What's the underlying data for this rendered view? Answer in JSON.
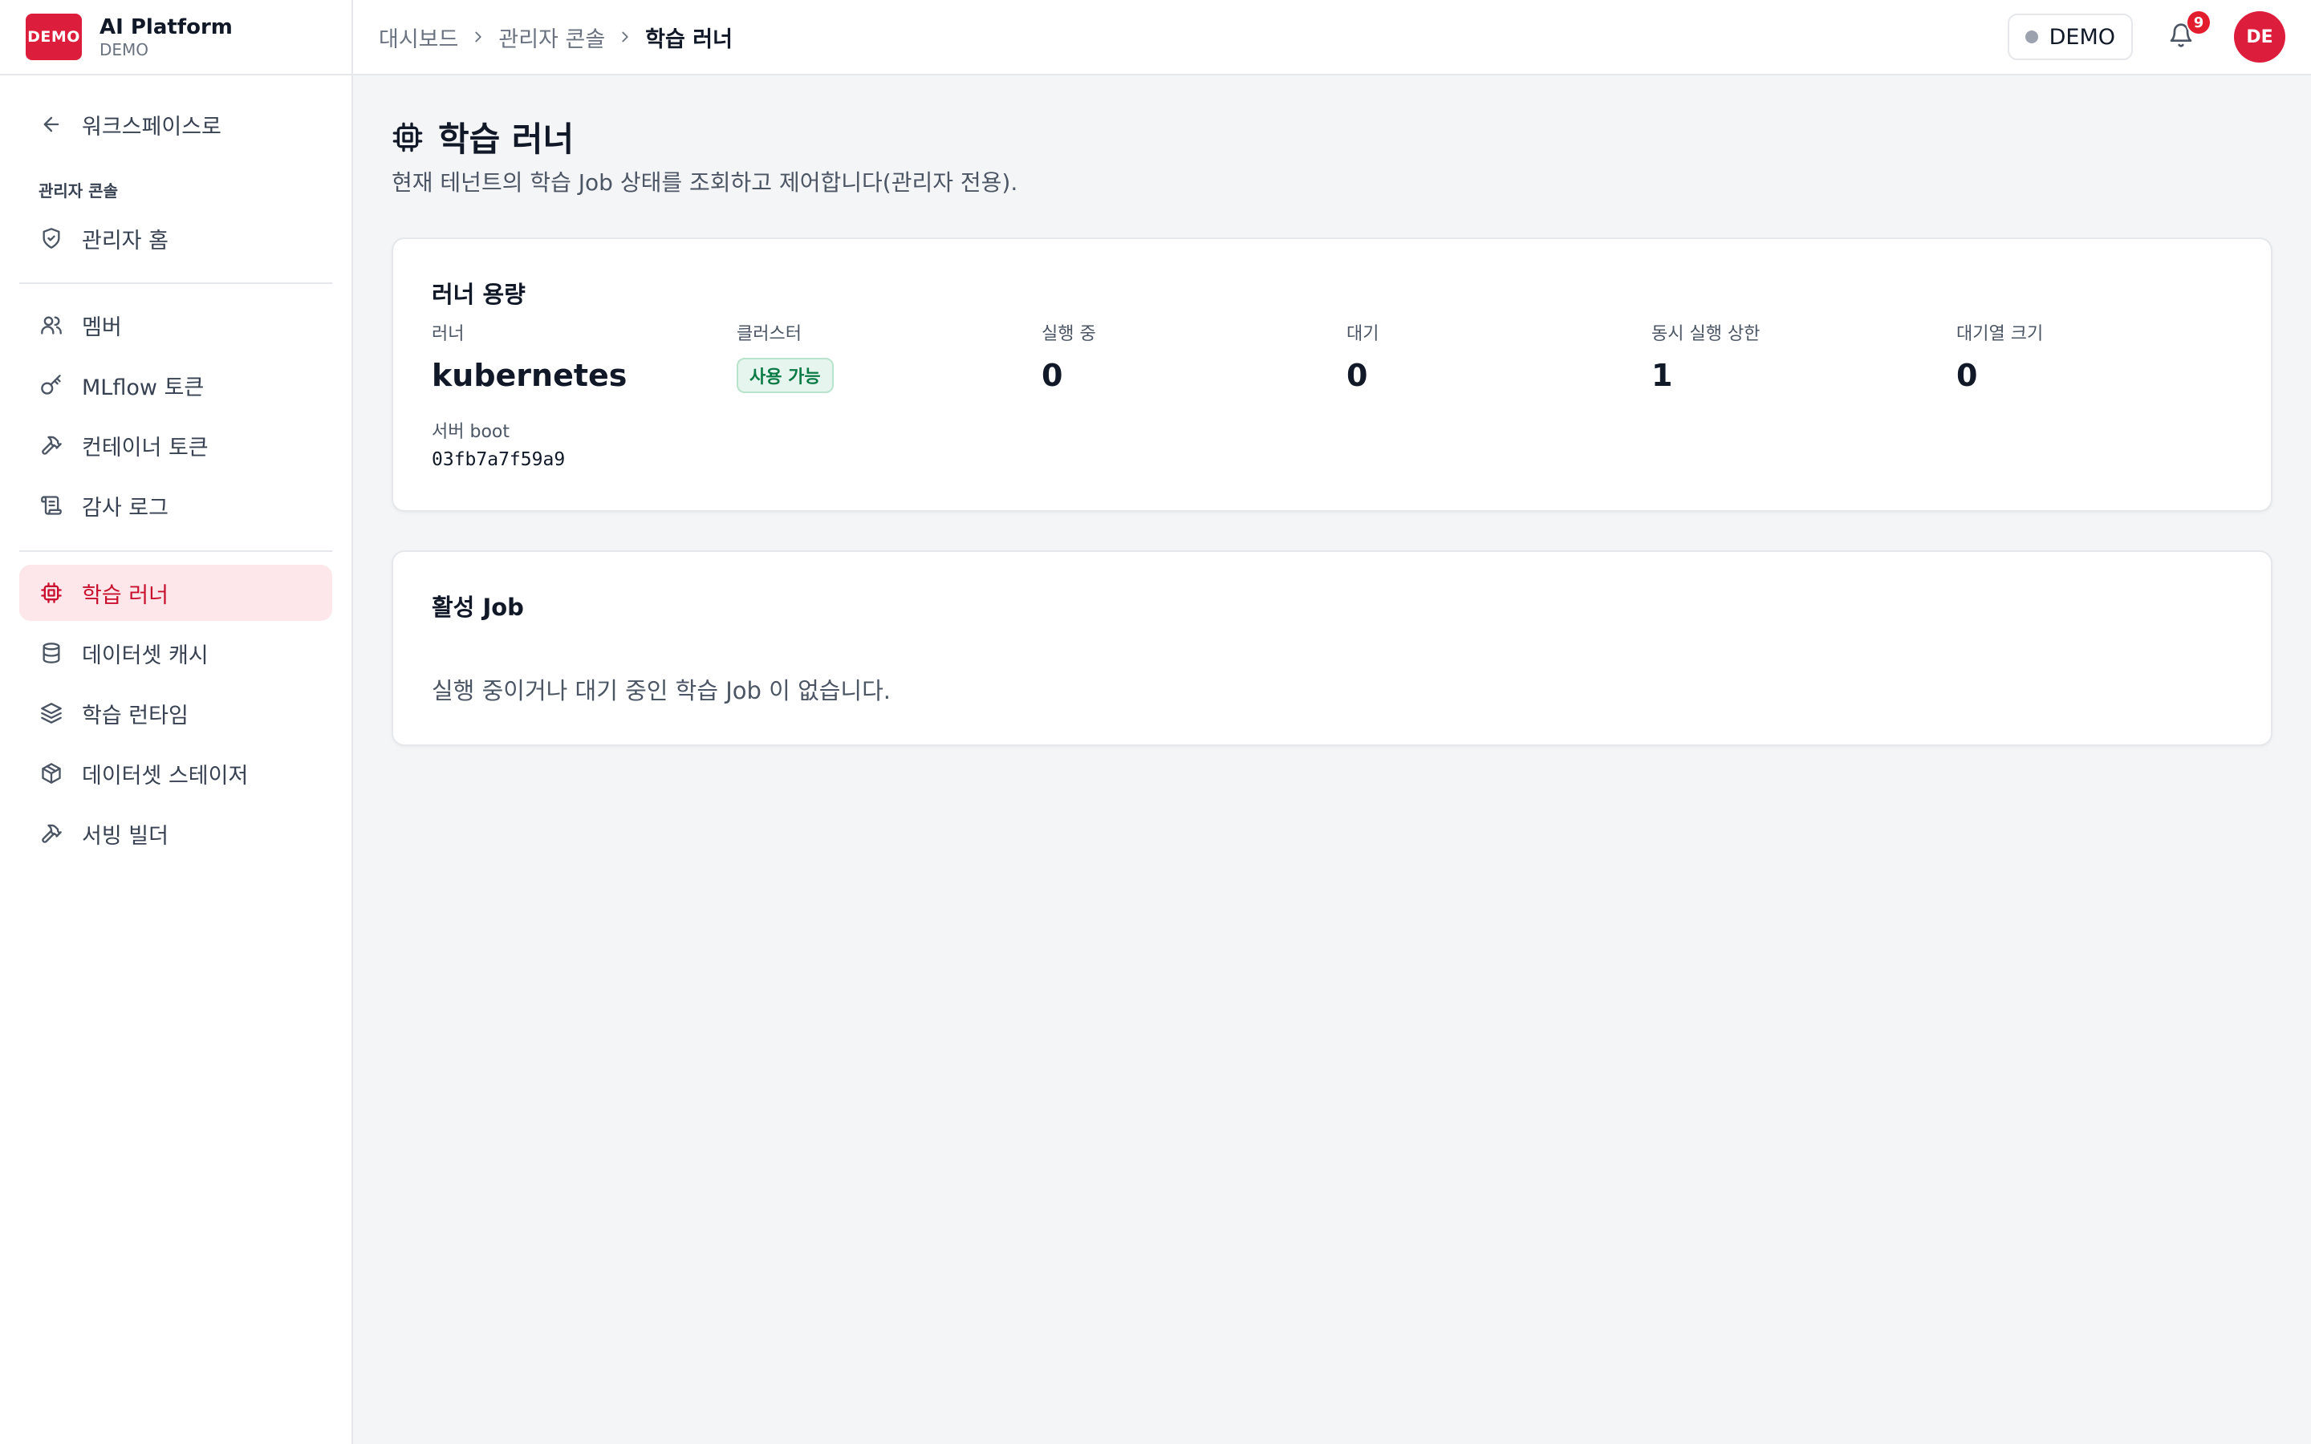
{
  "brand": {
    "logo": "DEMO",
    "title": "AI Platform",
    "subtitle": "DEMO"
  },
  "sidebar": {
    "back_label": "워크스페이스로",
    "section_label": "관리자 콘솔",
    "items": [
      {
        "label": "관리자 홈",
        "icon": "shield-check-icon"
      },
      {
        "label": "멤버",
        "icon": "users-icon"
      },
      {
        "label": "MLflow 토큰",
        "icon": "key-icon"
      },
      {
        "label": "컨테이너 토큰",
        "icon": "hammer-icon"
      },
      {
        "label": "감사 로그",
        "icon": "scroll-icon"
      },
      {
        "label": "학습 러너",
        "icon": "cpu-icon"
      },
      {
        "label": "데이터셋 캐시",
        "icon": "database-icon"
      },
      {
        "label": "학습 런타임",
        "icon": "layers-icon"
      },
      {
        "label": "데이터셋 스테이저",
        "icon": "package-icon"
      },
      {
        "label": "서빙 빌더",
        "icon": "hammer-icon"
      }
    ],
    "active_index": 5
  },
  "header": {
    "breadcrumb": [
      "대시보드",
      "관리자 콘솔",
      "학습 러너"
    ],
    "tenant": "DEMO",
    "notifications": "9",
    "avatar": "DE"
  },
  "page": {
    "title": "학습 러너",
    "description": "현재 테넌트의 학습 Job 상태를 조회하고 제어합니다(관리자 전용)."
  },
  "capacity": {
    "title": "러너 용량",
    "runner_label": "러너",
    "runner_value": "kubernetes",
    "cluster_label": "클러스터",
    "cluster_status": "사용 가능",
    "running_label": "실행 중",
    "running_value": "0",
    "waiting_label": "대기",
    "waiting_value": "0",
    "concurrency_label": "동시 실행 상한",
    "concurrency_value": "1",
    "queue_label": "대기열 크기",
    "queue_value": "0",
    "boot_label": "서버 boot",
    "boot_value": "03fb7a7f59a9"
  },
  "active_jobs": {
    "title": "활성 Job",
    "empty_message": "실행 중이거나 대기 중인 학습 Job 이 없습니다."
  },
  "colors": {
    "brand": "#dc1e3c",
    "active_bg": "#fde7ea",
    "success": "#0a7a46"
  }
}
